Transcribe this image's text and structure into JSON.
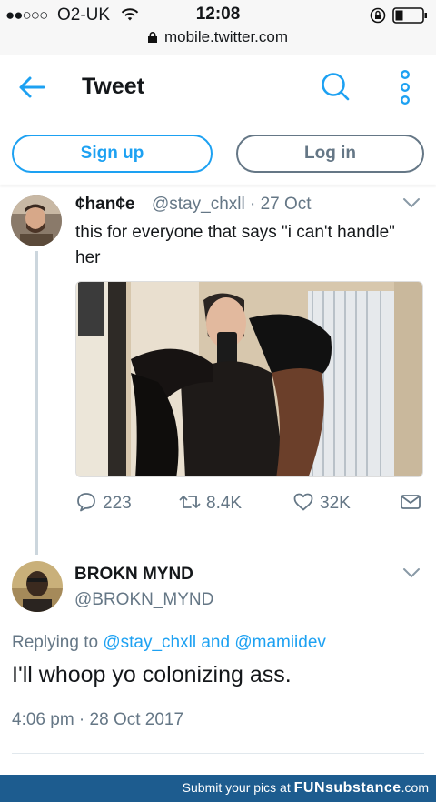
{
  "status_bar": {
    "signal": "●●○○○",
    "carrier": "O2-UK",
    "time": "12:08",
    "url": "mobile.twitter.com"
  },
  "header": {
    "title": "Tweet",
    "icons": [
      "back-arrow-icon",
      "search-icon",
      "more-vertical-icon"
    ]
  },
  "auth": {
    "signup_label": "Sign up",
    "login_label": "Log in"
  },
  "parent_tweet": {
    "name": "¢han¢e",
    "handle_date": "@stay_chxll · 27 Oct",
    "text": "this for everyone that says \"i can't handle\" her",
    "replies": "223",
    "retweets": "8.4K",
    "likes": "32K"
  },
  "main_tweet": {
    "name": "BROKN MYND",
    "handle": "@BROKN_MYND",
    "replying_prefix": "Replying to",
    "reply_user1": "@stay_chxll",
    "reply_and": "and",
    "reply_user2": "@mamiidev",
    "text": "I'll whoop yo colonizing ass.",
    "timestamp": "4:06 pm · 28 Oct 2017"
  },
  "footer": {
    "prefix": "Submit your pics at",
    "brand": "FUNsubstance",
    "suffix": ".com"
  },
  "colors": {
    "accent": "#1da1f2",
    "muted": "#657786",
    "footer": "#1d5c8f"
  }
}
